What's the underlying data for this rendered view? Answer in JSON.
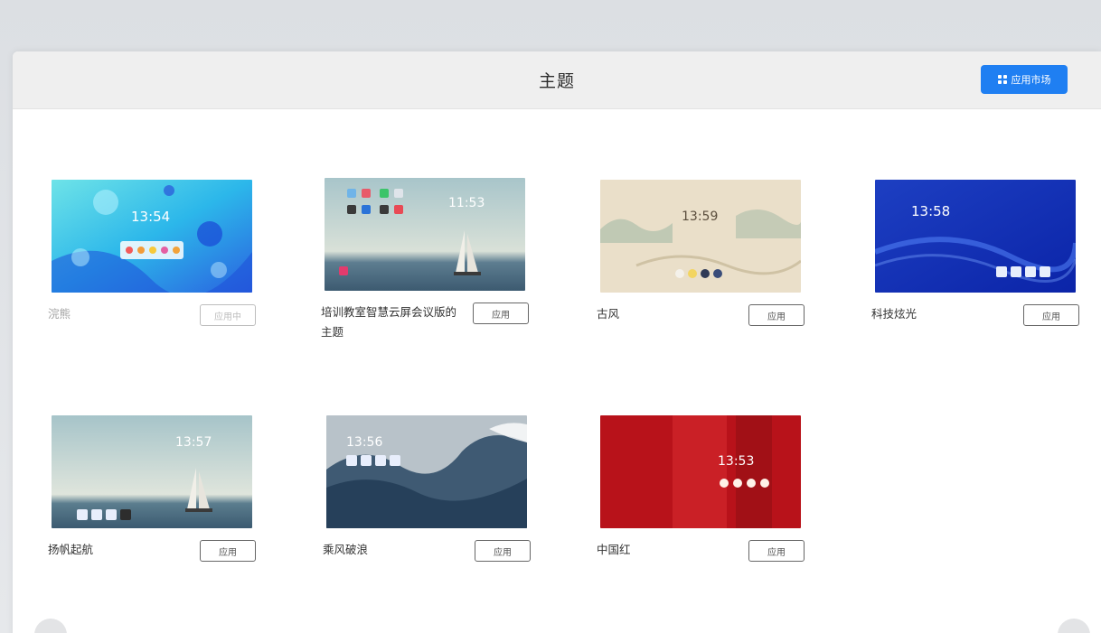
{
  "header": {
    "title": "主题",
    "store_button": "应用市场"
  },
  "themes": [
    {
      "name": "浣熊",
      "button": "应用中",
      "clock": "13:54"
    },
    {
      "name": "培训教室智慧云屏会议版的主题",
      "button": "应用",
      "clock": "11:53"
    },
    {
      "name": "古风",
      "button": "应用",
      "clock": "13:59"
    },
    {
      "name": "科技炫光",
      "button": "应用",
      "clock": "13:58"
    },
    {
      "name": "扬帆起航",
      "button": "应用",
      "clock": "13:57"
    },
    {
      "name": "乘风破浪",
      "button": "应用",
      "clock": "13:56"
    },
    {
      "name": "中国红",
      "button": "应用",
      "clock": "13:53"
    }
  ],
  "colors": {
    "accent": "#1f7ff2",
    "header_bg": "#efefef"
  }
}
